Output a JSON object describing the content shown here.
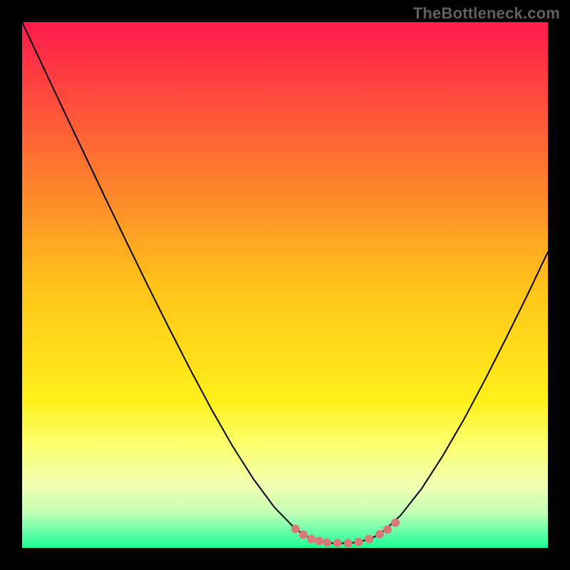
{
  "watermark": "TheBottleneck.com",
  "chart_data": {
    "type": "line",
    "title": "",
    "xlabel": "",
    "ylabel": "",
    "xlim": [
      0,
      100
    ],
    "ylim": [
      0,
      100
    ],
    "grid": false,
    "legend": false,
    "background_gradient": {
      "stops": [
        {
          "offset": 0.0,
          "color": "#ff1a4b"
        },
        {
          "offset": 0.5,
          "color": "#ffc21a"
        },
        {
          "offset": 0.72,
          "color": "#fff01a"
        },
        {
          "offset": 0.8,
          "color": "#fcff6a"
        },
        {
          "offset": 0.88,
          "color": "#f1ffb0"
        },
        {
          "offset": 0.93,
          "color": "#c8ffb6"
        },
        {
          "offset": 0.97,
          "color": "#66ffa8"
        },
        {
          "offset": 1.0,
          "color": "#1aff94"
        }
      ]
    },
    "series": [
      {
        "name": "bottleneck-curve",
        "stroke": "#000000",
        "stroke_width": 2,
        "x": [
          0,
          4,
          8,
          12,
          16,
          20,
          24,
          28,
          32,
          36,
          40,
          44,
          48,
          52,
          55,
          57,
          59,
          61,
          63,
          65,
          67,
          69,
          72,
          76,
          80,
          84,
          88,
          92,
          96,
          100
        ],
        "y": [
          100,
          91.5,
          83,
          74.6,
          66.2,
          57.9,
          49.7,
          41.7,
          33.9,
          26.4,
          19.4,
          13.1,
          7.7,
          3.6,
          1.7,
          1.1,
          0.9,
          0.9,
          1.0,
          1.4,
          2.1,
          3.4,
          6.2,
          11.3,
          17.5,
          24.4,
          31.9,
          39.8,
          47.9,
          56.3
        ]
      }
    ],
    "curve_highlight": {
      "color": "#d97a78",
      "radius": 6,
      "points_x": [
        52.0,
        53.5,
        55.0,
        56.5,
        58.0,
        60.0,
        62.0,
        64.0,
        66.0,
        68.0,
        69.5,
        71.0
      ],
      "points_y": [
        3.6,
        2.5,
        1.7,
        1.3,
        1.0,
        0.9,
        0.9,
        1.1,
        1.7,
        2.6,
        3.5,
        4.8
      ]
    }
  }
}
